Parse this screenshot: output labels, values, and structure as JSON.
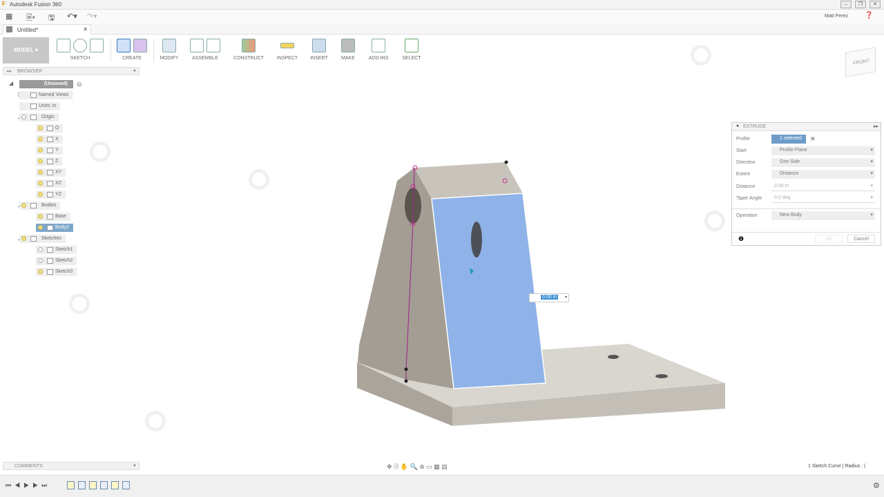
{
  "app": {
    "title": "Autodesk Fusion 360",
    "user": "Matt Perez",
    "document_tab": "Untitled*"
  },
  "toolbar": {
    "workspace": "MODEL",
    "groups": [
      "SKETCH",
      "CREATE",
      "MODIFY",
      "ASSEMBLE",
      "CONSTRUCT",
      "INSPECT",
      "INSERT",
      "MAKE",
      "ADD-INS",
      "SELECT"
    ]
  },
  "browser": {
    "title": "BROWSER",
    "root": "(Unsaved)",
    "items": [
      {
        "label": "Named Views",
        "level": 1
      },
      {
        "label": "Units: in",
        "level": 1
      },
      {
        "label": "Origin",
        "level": 1
      },
      {
        "label": "O",
        "level": 2
      },
      {
        "label": "X",
        "level": 2
      },
      {
        "label": "Y",
        "level": 2
      },
      {
        "label": "Z",
        "level": 2
      },
      {
        "label": "XY",
        "level": 2
      },
      {
        "label": "XZ",
        "level": 2
      },
      {
        "label": "YZ",
        "level": 2
      },
      {
        "label": "Bodies",
        "level": 1
      },
      {
        "label": "Base",
        "level": 2
      },
      {
        "label": "Body2",
        "level": 2,
        "selected": true
      },
      {
        "label": "Sketches",
        "level": 1
      },
      {
        "label": "Sketch1",
        "level": 2
      },
      {
        "label": "Sketch2",
        "level": 2
      },
      {
        "label": "Sketch3",
        "level": 2
      }
    ]
  },
  "viewcube": {
    "face": "FRONT"
  },
  "extrude": {
    "title": "EXTRUDE",
    "fields": [
      {
        "label": "Profile",
        "value": "1 selected"
      },
      {
        "label": "Start",
        "value": "Profile Plane"
      },
      {
        "label": "Direction",
        "value": "One Side"
      },
      {
        "label": "Extent",
        "value": "Distance"
      },
      {
        "label": "Distance",
        "value": "0.00 in"
      },
      {
        "label": "Taper Angle",
        "value": "0.0 deg"
      },
      {
        "label": "Operation",
        "value": "New Body"
      }
    ],
    "ok": "OK",
    "cancel": "Cancel"
  },
  "viewport": {
    "distance_input": "0.00 in"
  },
  "comments": {
    "title": "COMMENTS"
  },
  "status": {
    "text": "1 Sketch Curve | Radius : ("
  },
  "colors": {
    "selection": "#8fb3e8",
    "body": "#bdb7ad",
    "accent": "#7fa7cc"
  }
}
